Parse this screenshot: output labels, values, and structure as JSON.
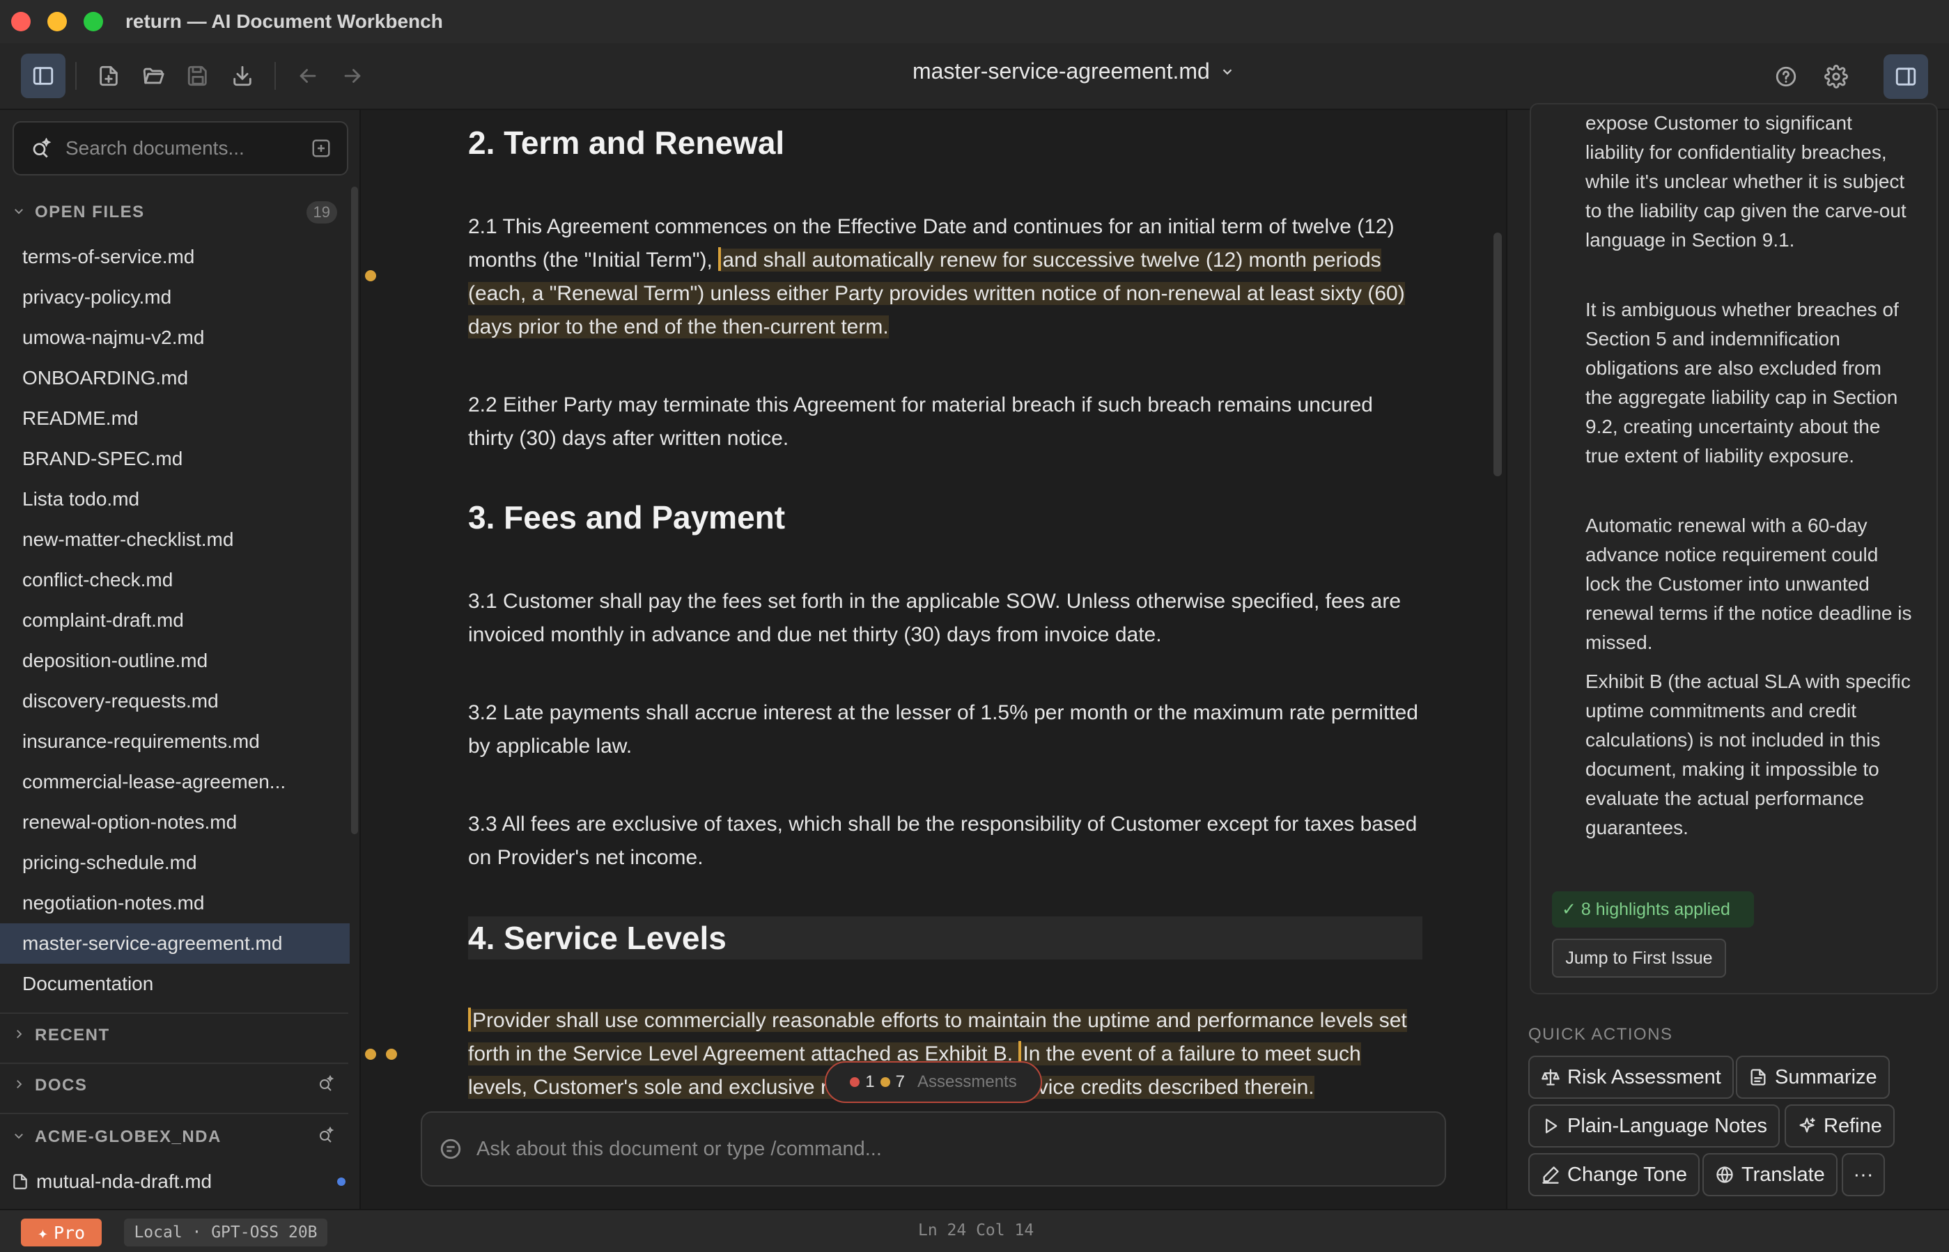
{
  "window": {
    "title": "return — AI Document Workbench"
  },
  "toolbar": {
    "document_title": "master-service-agreement.md"
  },
  "sidebar": {
    "search_placeholder": "Search documents...",
    "open_files": {
      "label": "OPEN FILES",
      "count": "19",
      "items": [
        "terms-of-service.md",
        "privacy-policy.md",
        "umowa-najmu-v2.md",
        "ONBOARDING.md",
        "README.md",
        "BRAND-SPEC.md",
        "Lista todo.md",
        "new-matter-checklist.md",
        "conflict-check.md",
        "complaint-draft.md",
        "deposition-outline.md",
        "discovery-requests.md",
        "insurance-requirements.md",
        "commercial-lease-agreemen...",
        "renewal-option-notes.md",
        "pricing-schedule.md",
        "negotiation-notes.md",
        "master-service-agreement.md",
        "Documentation"
      ]
    },
    "recent_label": "RECENT",
    "docs_label": "DOCS",
    "project_label": "ACME-GLOBEX_NDA",
    "project_file": "mutual-nda-draft.md"
  },
  "editor": {
    "h_term": "2. Term and Renewal",
    "p21_a": "2.1 This Agreement commences on the Effective Date and continues for an initial term of twelve (12) months (the \"Initial Term\"), ",
    "p21_b": "and shall automatically renew for successive twelve (12) month periods (each, a \"Renewal Term\") unless either Party provides written notice of non-renewal at least sixty (60) days prior to the end of the then-current term.",
    "p22": "2.2 Either Party may terminate this Agreement for material breach if such breach remains uncured thirty (30) days after written notice.",
    "h_fees": "3. Fees and Payment",
    "p31": "3.1 Customer shall pay the fees set forth in the applicable SOW. Unless otherwise specified, fees are invoiced monthly in advance and due net thirty (30) days from invoice date.",
    "p32": "3.2 Late payments shall accrue interest at the lesser of 1.5% per month or the maximum rate permitted by applicable law.",
    "p33": "3.3 All fees are exclusive of taxes, which shall be the responsibility of Customer except for taxes based on Provider's net income.",
    "h_sla": "4. Service Levels",
    "p41_a": "Provider shall use commercially reasonable efforts to maintain the uptime and performance levels set forth in the Service Level Agreement attached as Exhibit B. ",
    "p41_b": "In the event of a failure to meet such levels, Customer's sole and exclusive remedy shall be the service credits described therein."
  },
  "assessments": {
    "red_count": "1",
    "amber_count": "7",
    "label": "Assessments",
    "red_color": "#d9534a",
    "amber_color": "#d9a23a"
  },
  "chat": {
    "placeholder": "Ask about this document or type /command..."
  },
  "panel": {
    "paragraphs": [
      "expose Customer to significant liability for confidentiality breaches, while it's unclear whether it is subject to the liability cap given the carve-out language in Section 9.1.",
      "It is ambiguous whether breaches of Section 5 and indemnification obligations are also excluded from the aggregate liability cap in Section 9.2, creating uncertainty about the true extent of liability exposure.",
      "Automatic renewal with a 60-day advance notice requirement could lock the Customer into unwanted renewal terms if the notice deadline is missed.",
      "Exhibit B (the actual SLA with specific uptime commitments and credit calculations) is not included in this document, making it impossible to evaluate the actual performance guarantees."
    ],
    "highlights_badge": "✓ 8 highlights applied",
    "jump_button": "Jump to First Issue",
    "quick_actions_label": "QUICK ACTIONS",
    "actions": {
      "risk": "Risk Assessment",
      "summarize": "Summarize",
      "plain": "Plain-Language Notes",
      "refine": "Refine",
      "tone": "Change Tone",
      "translate": "Translate",
      "more": "···"
    }
  },
  "status": {
    "plan": "Pro",
    "model": "Local · GPT-OSS 20B",
    "cursor": "Ln 24 Col 14"
  }
}
